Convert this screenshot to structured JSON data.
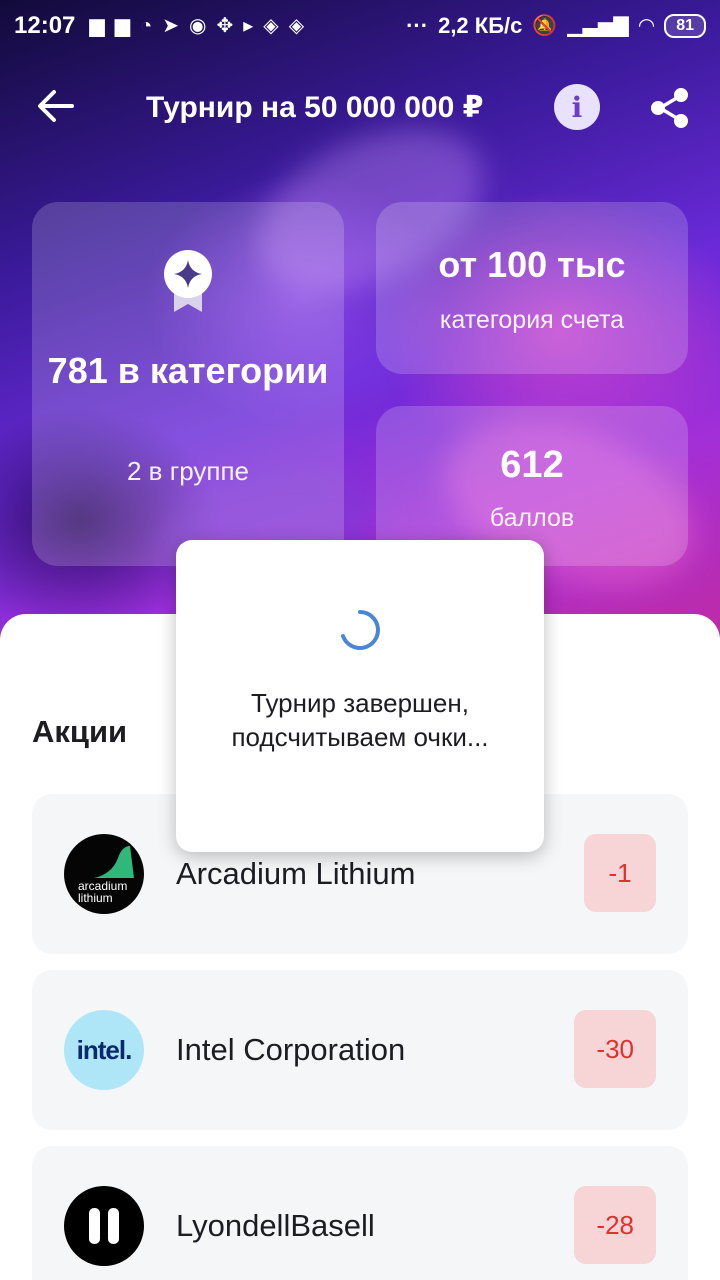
{
  "status_bar": {
    "time": "12:07",
    "speed": "2,2 КБ/с",
    "battery": "81",
    "left_icons": [
      "message-icon",
      "message-icon",
      "sync-icon",
      "telegram-icon",
      "circle-icon",
      "pinwheel-icon",
      "play-icon",
      "dropbox-icon",
      "dropbox-icon"
    ],
    "more": "···"
  },
  "header": {
    "title": "Турнир на 50 000 000 ₽",
    "back_icon": "arrow-left-icon",
    "info_icon": "info-icon",
    "share_icon": "share-icon"
  },
  "stats": {
    "rank_value": "781 в категории",
    "rank_sub": "2 в группе",
    "category_value": "от 100 тыс",
    "category_sub": "категория счета",
    "points_value": "612",
    "points_sub": "баллов"
  },
  "section": {
    "title": "Акции"
  },
  "stocks": [
    {
      "name": "Arcadium Lithium",
      "change": "-1",
      "logo_line1": "arcadium",
      "logo_line2": "lithium"
    },
    {
      "name": "Intel Corporation",
      "change": "-30",
      "logo_text": "intel."
    },
    {
      "name": "LyondellBasell",
      "change": "-28"
    }
  ],
  "popup": {
    "message": "Турнир завершен, подсчитываем очки..."
  },
  "colors": {
    "accent": "#6a3ec8",
    "negative": "#e0312f",
    "negative_bg": "#f7d4d6",
    "spinner": "#4a86d8"
  }
}
